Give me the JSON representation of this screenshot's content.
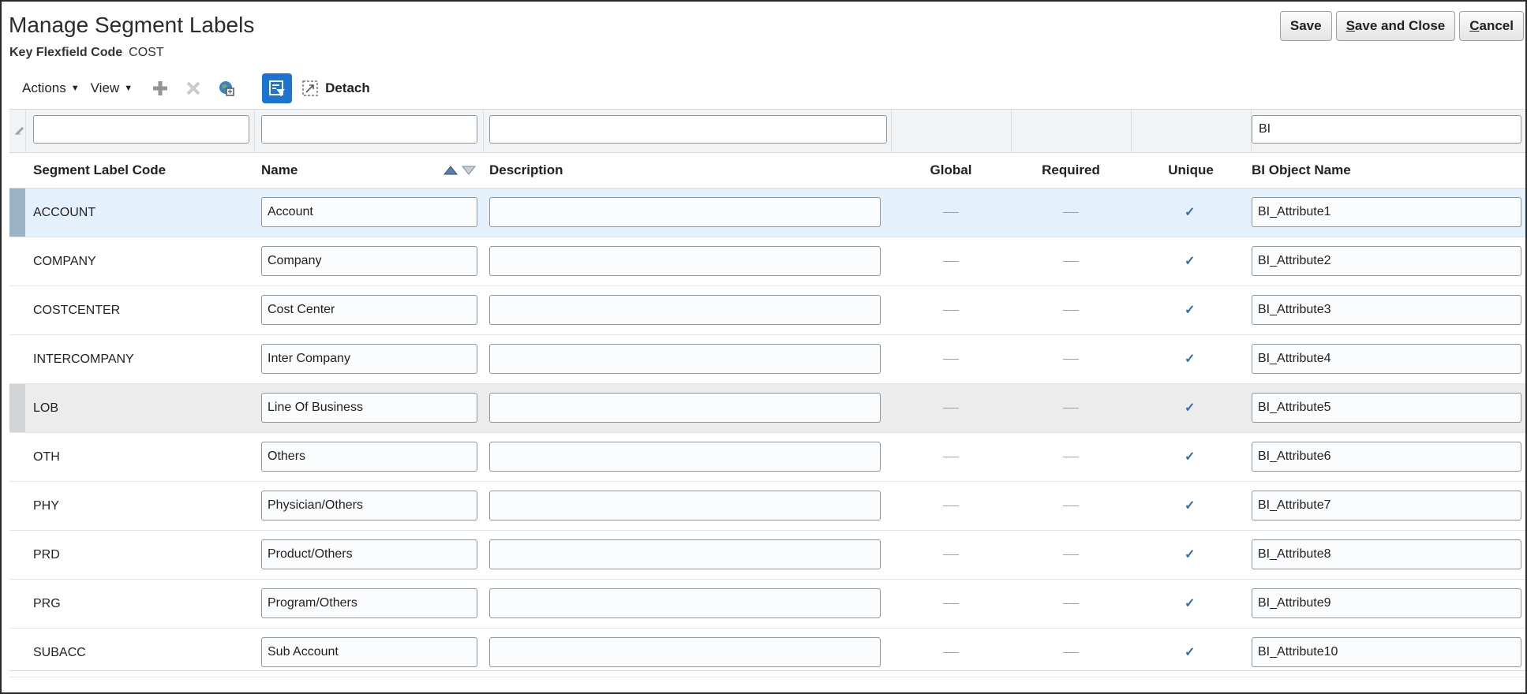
{
  "page": {
    "title": "Manage Segment Labels",
    "kff_label": "Key Flexfield Code",
    "kff_value": "COST"
  },
  "buttons": {
    "save": "Save",
    "save_close_mn": "S",
    "save_close_rest": "ave and Close",
    "cancel_mn": "C",
    "cancel_rest": "ancel"
  },
  "toolbar": {
    "actions": "Actions",
    "view": "View",
    "detach": "Detach",
    "icons": [
      "add-icon",
      "delete-icon",
      "globe-query-icon",
      "query-by-example-icon",
      "detach-icon"
    ]
  },
  "filters": {
    "code": "",
    "name": "",
    "description": "",
    "bi_object_name": "BI"
  },
  "columns": {
    "code": "Segment Label Code",
    "name": "Name",
    "description": "Description",
    "global": "Global",
    "required": "Required",
    "unique": "Unique",
    "bi_object_name": "BI Object Name"
  },
  "rows": [
    {
      "code": "ACCOUNT",
      "name": "Account",
      "description": "",
      "global": false,
      "required": false,
      "unique": true,
      "bi": "BI_Attribute1"
    },
    {
      "code": "COMPANY",
      "name": "Company",
      "description": "",
      "global": false,
      "required": false,
      "unique": true,
      "bi": "BI_Attribute2"
    },
    {
      "code": "COSTCENTER",
      "name": "Cost Center",
      "description": "",
      "global": false,
      "required": false,
      "unique": true,
      "bi": "BI_Attribute3"
    },
    {
      "code": "INTERCOMPANY",
      "name": "Inter Company",
      "description": "",
      "global": false,
      "required": false,
      "unique": true,
      "bi": "BI_Attribute4"
    },
    {
      "code": "LOB",
      "name": "Line Of Business",
      "description": "",
      "global": false,
      "required": false,
      "unique": true,
      "bi": "BI_Attribute5"
    },
    {
      "code": "OTH",
      "name": "Others",
      "description": "",
      "global": false,
      "required": false,
      "unique": true,
      "bi": "BI_Attribute6"
    },
    {
      "code": "PHY",
      "name": "Physician/Others",
      "description": "",
      "global": false,
      "required": false,
      "unique": true,
      "bi": "BI_Attribute7"
    },
    {
      "code": "PRD",
      "name": "Product/Others",
      "description": "",
      "global": false,
      "required": false,
      "unique": true,
      "bi": "BI_Attribute8"
    },
    {
      "code": "PRG",
      "name": "Program/Others",
      "description": "",
      "global": false,
      "required": false,
      "unique": true,
      "bi": "BI_Attribute9"
    },
    {
      "code": "SUBACC",
      "name": "Sub Account",
      "description": "",
      "global": false,
      "required": false,
      "unique": true,
      "bi": "BI_Attribute10"
    }
  ],
  "colors": {
    "accent": "#1b74d1",
    "selected_row": "#e4f0fb",
    "check": "#2f6db5"
  }
}
